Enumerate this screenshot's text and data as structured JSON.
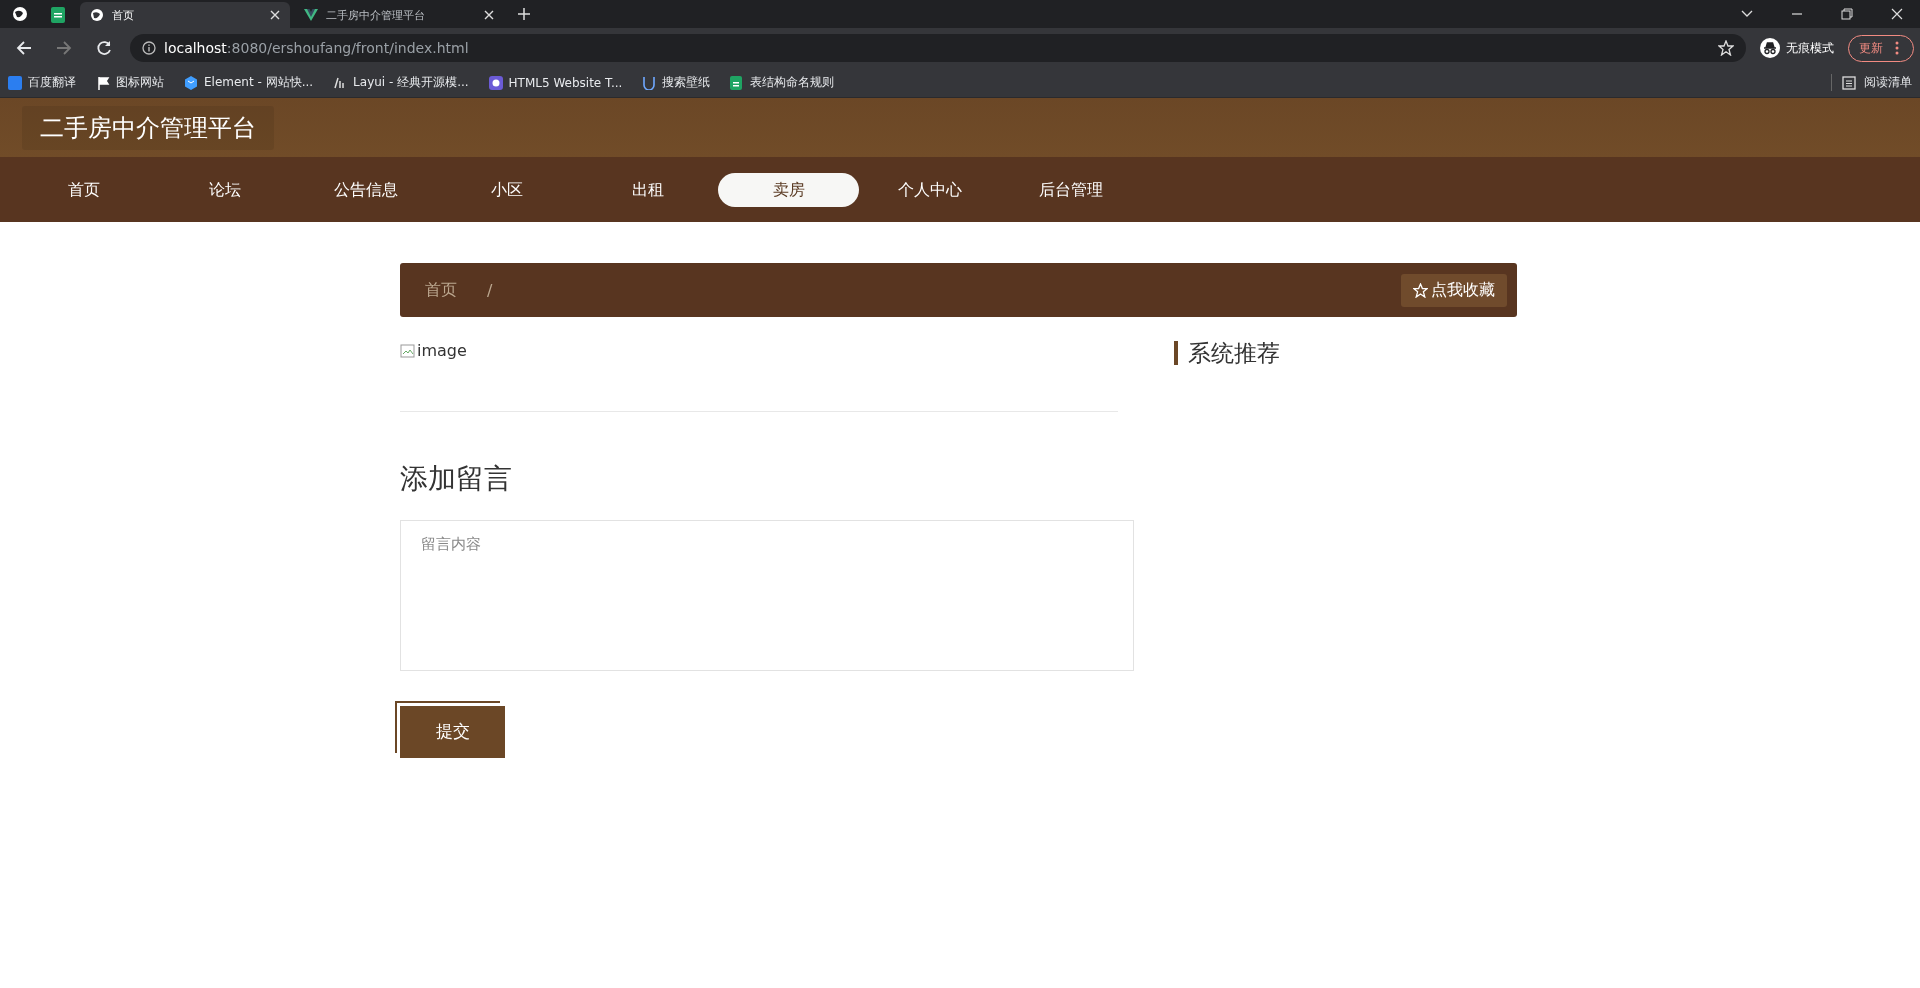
{
  "browser": {
    "tabs": [
      {
        "kind": "pinned",
        "selected": false
      },
      {
        "kind": "normal",
        "label": "首页",
        "selected": true
      },
      {
        "kind": "normal",
        "label": "二手房中介管理平台",
        "selected": false
      }
    ],
    "address": {
      "host": "localhost",
      "path": ":8080/ershoufang/front/index.html"
    },
    "profile_label": "无痕模式",
    "update_label": "更新",
    "bookmarks": [
      "百度翻译",
      "图标网站",
      "Element - 网站快...",
      "Layui - 经典开源模...",
      "HTML5 Website T...",
      "搜索壁纸",
      "表结构命名规则"
    ],
    "reading_list": "阅读清单"
  },
  "site": {
    "title": "二手房中介管理平台",
    "nav": [
      {
        "label": "首页",
        "selected": false
      },
      {
        "label": "论坛",
        "selected": false
      },
      {
        "label": "公告信息",
        "selected": false
      },
      {
        "label": "小区",
        "selected": false
      },
      {
        "label": "出租",
        "selected": false
      },
      {
        "label": "卖房",
        "selected": true
      },
      {
        "label": "个人中心",
        "selected": false
      },
      {
        "label": "后台管理",
        "selected": false
      }
    ]
  },
  "breadcrumb": {
    "items": [
      "首页"
    ],
    "separator": "/",
    "favorite_button": "点我收藏"
  },
  "image_alt": "image",
  "comment": {
    "heading": "添加留言",
    "placeholder": "留言内容",
    "submit": "提交"
  },
  "sidebar": {
    "heading": "系统推荐"
  }
}
